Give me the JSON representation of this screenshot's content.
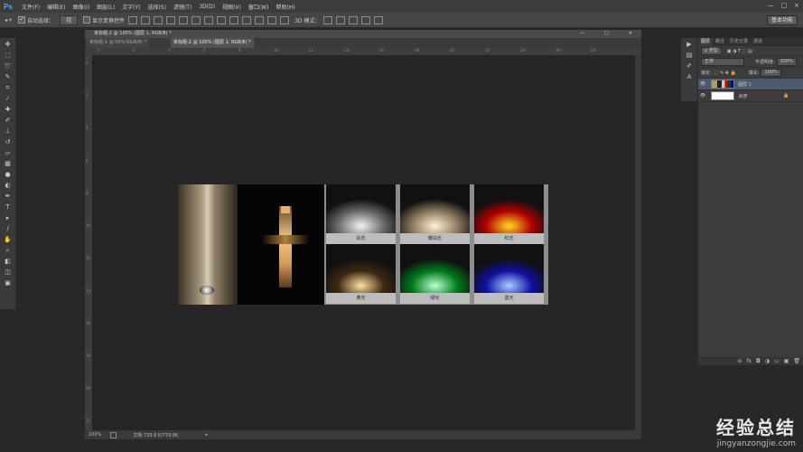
{
  "app": {
    "logo": "Ps"
  },
  "menu": [
    "文件(F)",
    "编辑(E)",
    "图像(I)",
    "图层(L)",
    "文字(Y)",
    "选择(S)",
    "滤镜(T)",
    "3D(D)",
    "视图(V)",
    "窗口(W)",
    "帮助(H)"
  ],
  "window_controls": [
    "—",
    "□",
    "×"
  ],
  "options": {
    "auto_select_label": "自动选择：",
    "auto_select_value": "组",
    "show_transform_label": "显示变换控件",
    "mode_3d": "3D 模式：",
    "workspace": "基本功能"
  },
  "document": {
    "title": "未标题-2 @ 100% (图层 1, RGB/8) *",
    "tabs": [
      "未标题-1 @ 50%(RGB/8) *",
      "未标题-2 @ 100% (图层 1, RGB/8) *"
    ],
    "controls": [
      "—",
      "□",
      "×"
    ],
    "h_ticks": [
      "0",
      "2",
      "4",
      "6",
      "8",
      "10",
      "12",
      "14",
      "16",
      "18",
      "20",
      "22",
      "24",
      "26",
      "28"
    ],
    "v_ticks": [
      "0",
      "2",
      "4",
      "6",
      "8",
      "10",
      "12",
      "14",
      "16",
      "18",
      "20",
      "22"
    ]
  },
  "artwork": {
    "swatches": [
      {
        "label": "白光",
        "color": "#f4f4f4",
        "bg": "#6a6a6a"
      },
      {
        "label": "暖白光",
        "color": "#fff1d6",
        "bg": "#8c7a5e"
      },
      {
        "label": "红光",
        "color": "#ffdd22",
        "bg": "#b30000"
      },
      {
        "label": "黄光",
        "color": "#ffe1a0",
        "bg": "#3e2a12"
      },
      {
        "label": "绿光",
        "color": "#b8ffd0",
        "bg": "#007a1a"
      },
      {
        "label": "蓝光",
        "color": "#a8d0ff",
        "bg": "#1010a0"
      }
    ]
  },
  "status": {
    "zoom": "100%",
    "doc_size": "文档:739.8 K/739.8K"
  },
  "layers_panel": {
    "tabs": [
      "图层",
      "路径",
      "历史记录",
      "通道"
    ],
    "kind_filter": "ρ 类型",
    "blend_mode": "正常",
    "opacity_label": "不透明度:",
    "opacity_value": "100%",
    "lock_label": "锁定:",
    "fill_label": "填充:",
    "fill_value": "100%",
    "layers": [
      {
        "name": "图层 1",
        "active": true
      },
      {
        "name": "背景",
        "active": false
      }
    ],
    "footer_icons": [
      "⊖",
      "fx",
      "◘",
      "◑",
      "▭",
      "▣",
      "🗑"
    ]
  },
  "watermark": {
    "main": "经验总结",
    "sub": "jingyanzongjie.com"
  }
}
